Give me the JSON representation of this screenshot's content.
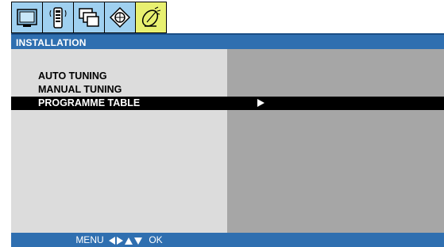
{
  "icon_bar": {
    "icons": [
      {
        "name": "screen-icon"
      },
      {
        "name": "remote-icon"
      },
      {
        "name": "windows-icon"
      },
      {
        "name": "globe-icon"
      },
      {
        "name": "satellite-dish-icon",
        "active": true
      }
    ]
  },
  "menu": {
    "title": "INSTALLATION",
    "items": [
      {
        "label": "AUTO TUNING"
      },
      {
        "label": "MANUAL TUNING"
      },
      {
        "label": "PROGRAMME TABLE",
        "selected": true
      }
    ]
  },
  "footer": {
    "menu_label": "MENU",
    "ok_label": "OK"
  },
  "colors": {
    "header_blue": "#2f6fb0",
    "icon_bg": "#9fd0f0",
    "active_icon_bg": "#e8f070",
    "left_panel": "#dcdcdc",
    "right_panel": "#a6a6a6"
  }
}
